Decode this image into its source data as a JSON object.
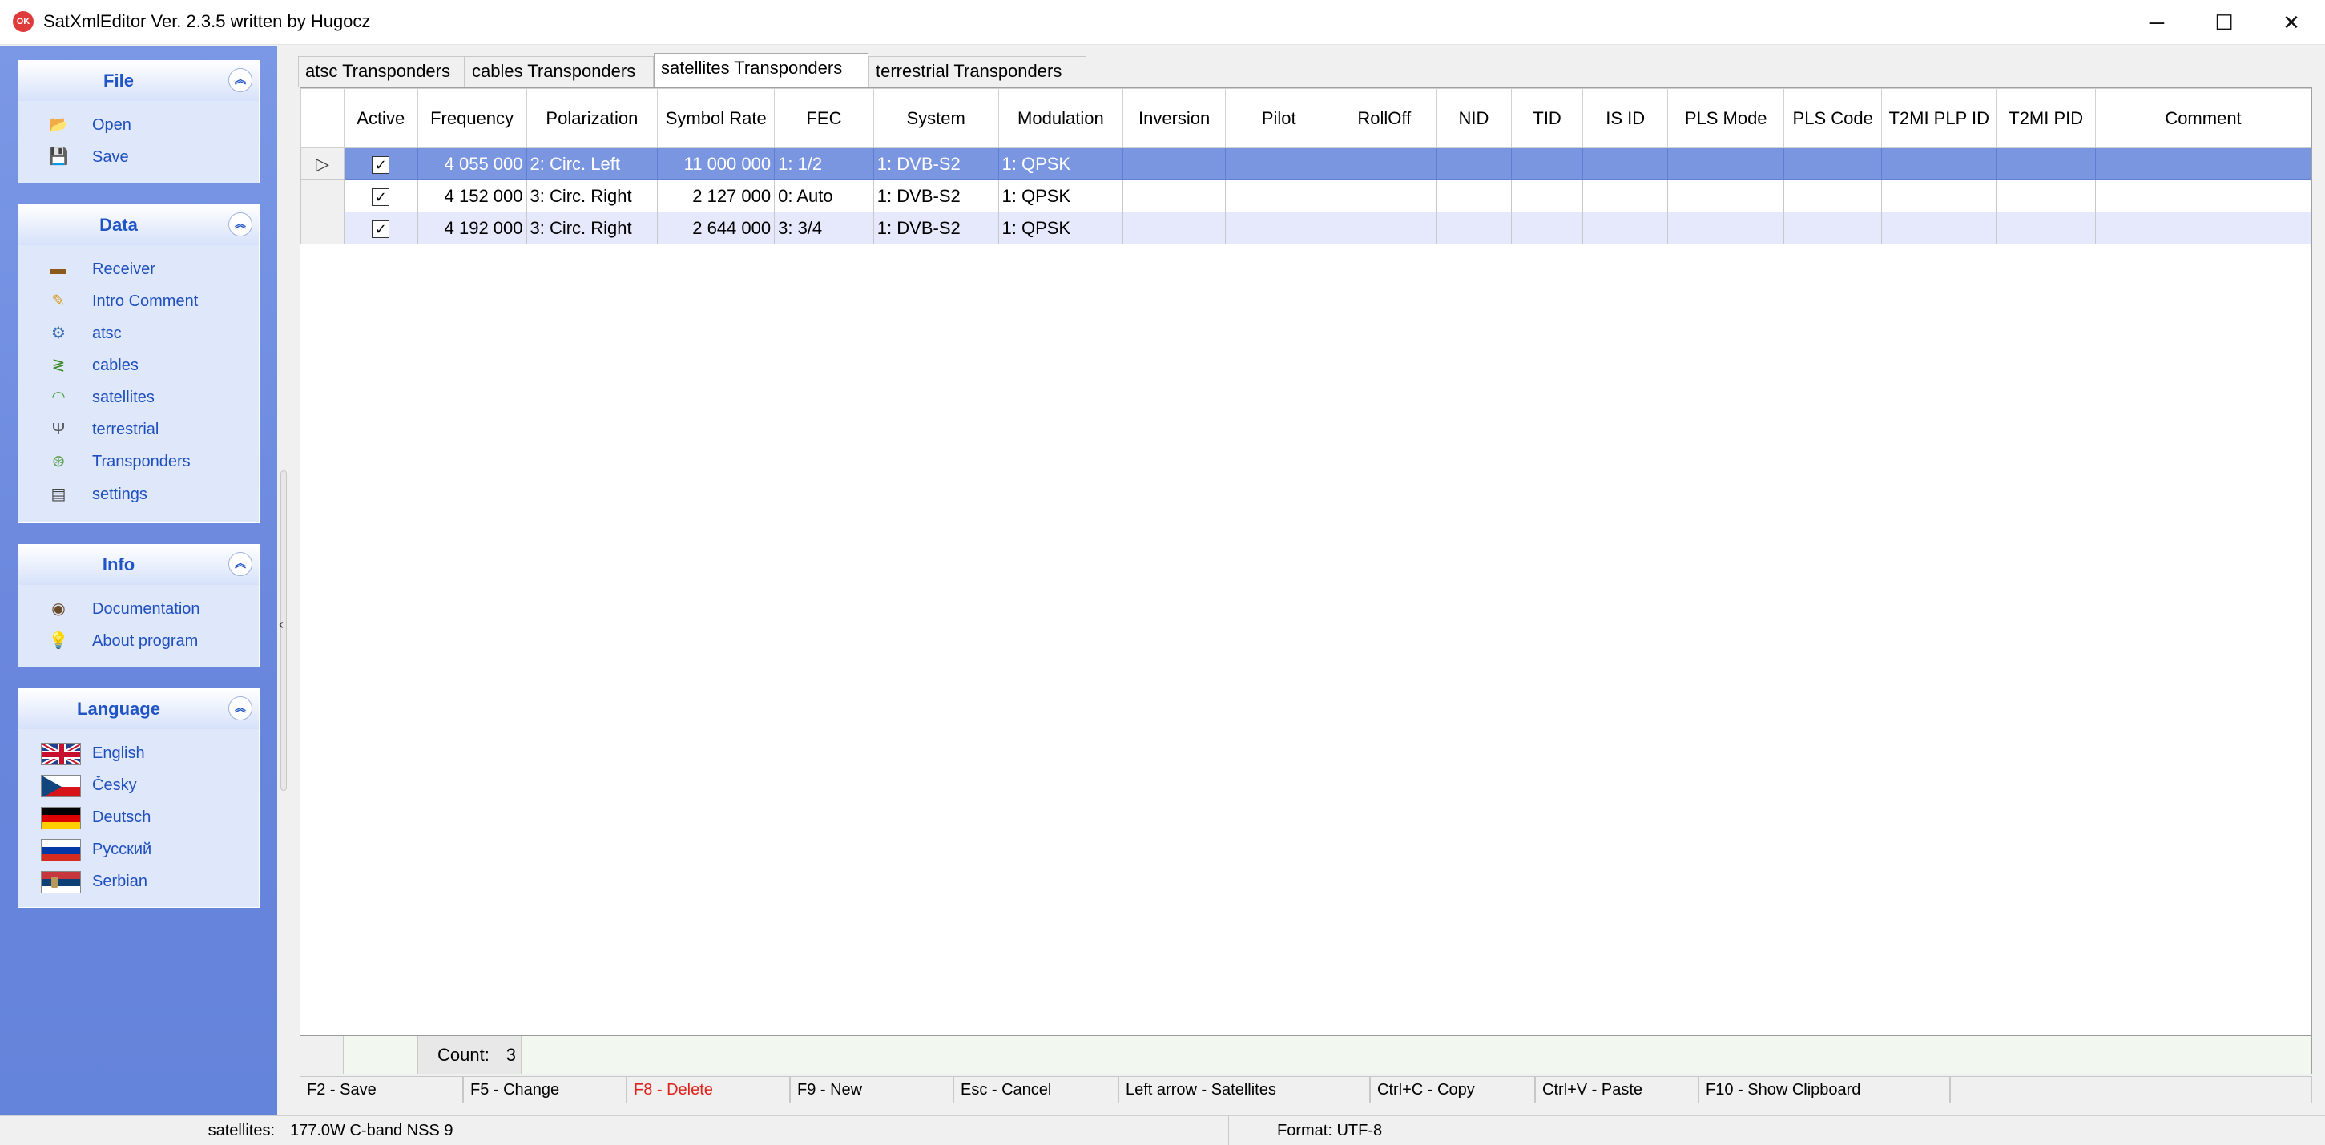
{
  "window": {
    "app_icon_text": "OK",
    "title": "SatXmlEditor Ver. 2.3.5 written by Hugocz",
    "minimize": "─",
    "maximize": "☐",
    "close": "✕"
  },
  "sidebar": {
    "file": {
      "title": "File",
      "items": [
        {
          "label": "Open",
          "icon": "folder-open-icon"
        },
        {
          "label": "Save",
          "icon": "floppy-disk-icon"
        }
      ]
    },
    "data": {
      "title": "Data",
      "items": [
        {
          "label": "Receiver",
          "icon": "receiver-icon"
        },
        {
          "label": "Intro Comment",
          "icon": "comment-icon"
        },
        {
          "label": "atsc",
          "icon": "gears-icon"
        },
        {
          "label": "cables",
          "icon": "cable-icon"
        },
        {
          "label": "satellites",
          "icon": "wifi-signal-icon"
        },
        {
          "label": "terrestrial",
          "icon": "antenna-icon"
        },
        {
          "label": "Transponders",
          "icon": "transponder-icon"
        },
        {
          "label": "settings",
          "icon": "settings-book-icon"
        }
      ]
    },
    "info": {
      "title": "Info",
      "items": [
        {
          "label": "Documentation",
          "icon": "eye-icon"
        },
        {
          "label": "About program",
          "icon": "lightbulb-icon"
        }
      ]
    },
    "language": {
      "title": "Language",
      "items": [
        {
          "label": "English",
          "icon": "flag-uk-icon"
        },
        {
          "label": "Česky",
          "icon": "flag-czech-icon"
        },
        {
          "label": "Deutsch",
          "icon": "flag-germany-icon"
        },
        {
          "label": "Русский",
          "icon": "flag-russia-icon"
        },
        {
          "label": "Serbian",
          "icon": "flag-serbia-icon"
        }
      ]
    }
  },
  "tabs": [
    {
      "label": "atsc Transponders",
      "active": false
    },
    {
      "label": "cables Transponders",
      "active": false
    },
    {
      "label": "satellites Transponders",
      "active": true
    },
    {
      "label": "terrestrial Transponders",
      "active": false
    }
  ],
  "grid": {
    "columns": [
      "Active",
      "Frequency",
      "Polarization",
      "Symbol Rate",
      "FEC",
      "System",
      "Modulation",
      "Inversion",
      "Pilot",
      "RollOff",
      "NID",
      "TID",
      "IS ID",
      "PLS Mode",
      "PLS Code",
      "T2MI PLP ID",
      "T2MI PID",
      "Comment"
    ],
    "rows": [
      {
        "selected": true,
        "active": true,
        "frequency": "4 055 000",
        "polarization": "2: Circ. Left",
        "symbol_rate": "11 000 000",
        "fec": "1: 1/2",
        "system": "1: DVB-S2",
        "modulation": "1: QPSK"
      },
      {
        "selected": false,
        "active": true,
        "frequency": "4 152 000",
        "polarization": "3: Circ. Right",
        "symbol_rate": "2 127 000",
        "fec": "0: Auto",
        "system": "1: DVB-S2",
        "modulation": "1: QPSK"
      },
      {
        "selected": false,
        "active": true,
        "frequency": "4 192 000",
        "polarization": "3: Circ. Right",
        "symbol_rate": "2 644 000",
        "fec": "3: 3/4",
        "system": "1: DVB-S2",
        "modulation": "1: QPSK"
      }
    ],
    "footer": {
      "count_label": "Count:",
      "count_value": "3"
    }
  },
  "shortcuts": [
    {
      "label": "F2 - Save"
    },
    {
      "label": "F5 - Change"
    },
    {
      "label": "F8 - Delete"
    },
    {
      "label": "F9 - New"
    },
    {
      "label": "Esc - Cancel"
    },
    {
      "label": "Left arrow - Satellites"
    },
    {
      "label": "Ctrl+C - Copy"
    },
    {
      "label": "Ctrl+V - Paste"
    },
    {
      "label": "F10 - Show Clipboard"
    }
  ],
  "statusbar": {
    "label": "satellites:",
    "value": "177.0W C-band NSS 9",
    "format": "Format: UTF-8"
  },
  "colors": {
    "accent": "#2155c6",
    "sidebar": "#7b98e6",
    "selected_row": "#7a96e0",
    "alt_row": "#e6e9fb",
    "delete_shortcut": "#e0221b"
  }
}
